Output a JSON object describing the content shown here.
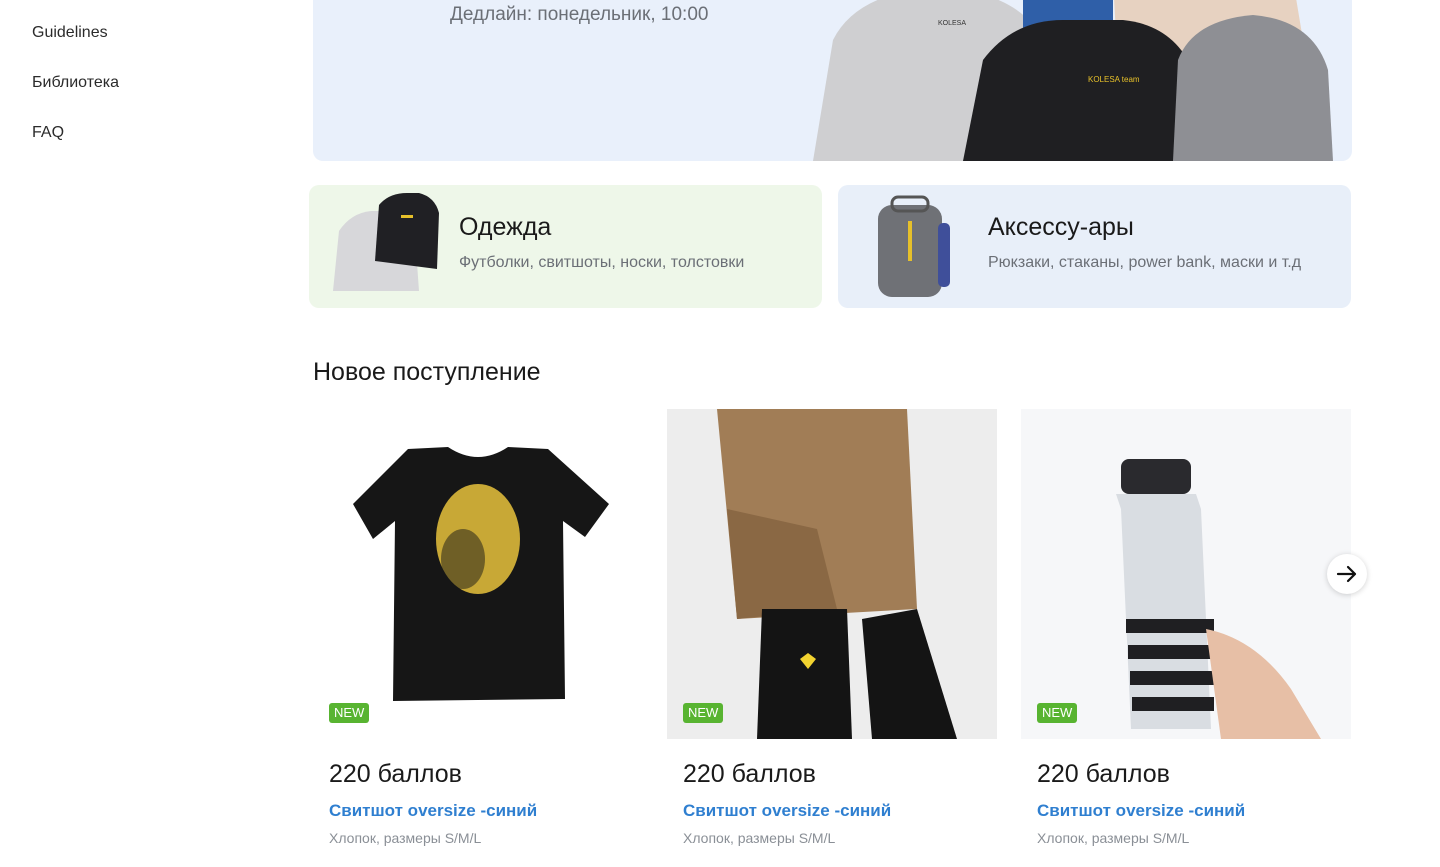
{
  "sidebar": {
    "items": [
      {
        "label": "Guidelines"
      },
      {
        "label": "Библиотека"
      },
      {
        "label": "FAQ"
      }
    ]
  },
  "hero": {
    "deadline": "Дедлайн: понедельник, 10:00",
    "logo_text": "KOLESA team"
  },
  "categories": [
    {
      "title": "Одежда",
      "subtitle": "Футболки, свитшоты, носки, толстовки"
    },
    {
      "title": "Аксессу-ары",
      "subtitle": "Рюкзаки, стаканы, power bank, маски и т.д"
    }
  ],
  "section": {
    "title": "Новое поступление"
  },
  "products": [
    {
      "badge": "NEW",
      "price": "220 баллов",
      "name": "Свитшот oversize -синий",
      "desc": "Хлопок, размеры S/M/L"
    },
    {
      "badge": "NEW",
      "price": "220 баллов",
      "name": "Свитшот oversize -синий",
      "desc": "Хлопок, размеры S/M/L"
    },
    {
      "badge": "NEW",
      "price": "220 баллов",
      "name": "Свитшот oversize -синий",
      "desc": "Хлопок, размеры S/M/L"
    }
  ],
  "colors": {
    "accent_blue": "#2f7fd0",
    "badge_green": "#58b431",
    "hero_bg": "#e9f0fb",
    "clothes_bg": "#eef7e9",
    "accessories_bg": "#e8eff9"
  },
  "icons": {
    "next": "arrow-right-icon"
  }
}
